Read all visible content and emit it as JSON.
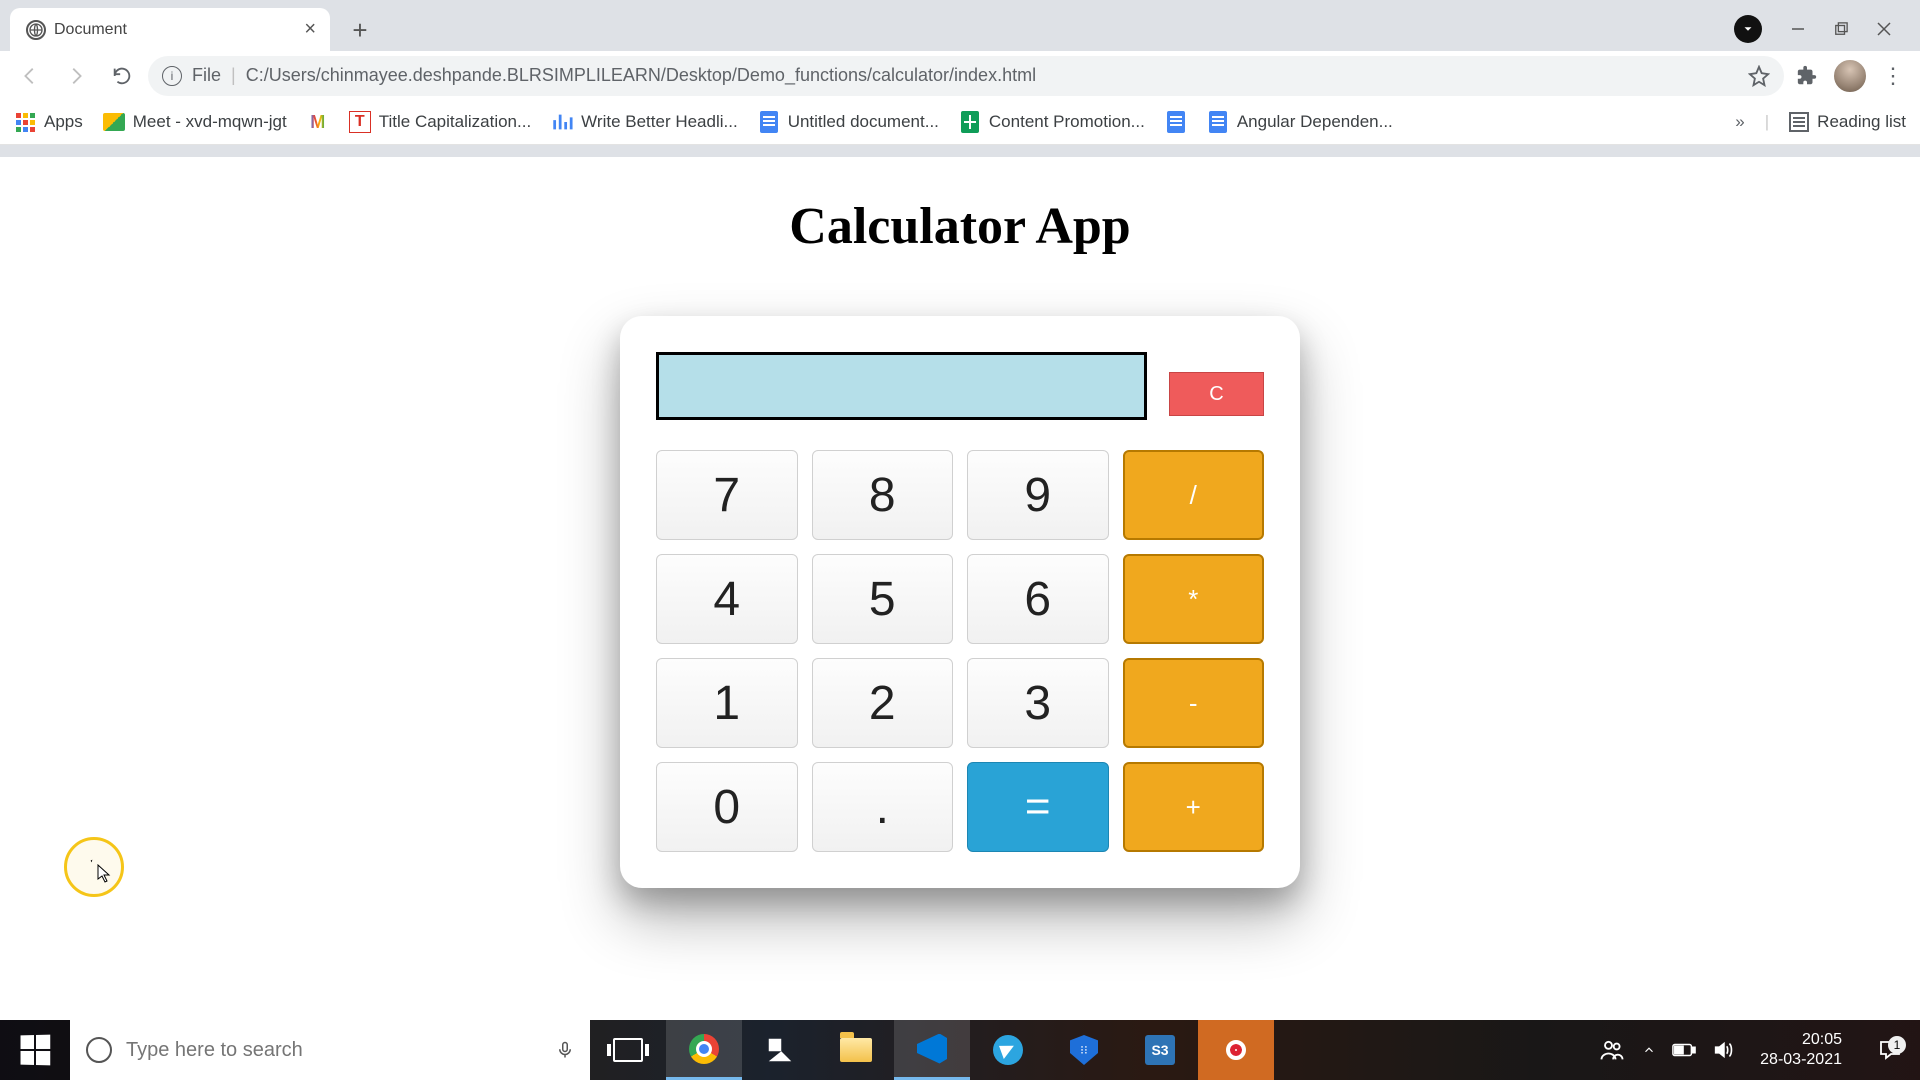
{
  "browser": {
    "tab_title": "Document",
    "file_label": "File",
    "url": "C:/Users/chinmayee.deshpande.BLRSIMPLILEARN/Desktop/Demo_functions/calculator/index.html"
  },
  "bookmarks": {
    "apps": "Apps",
    "meet": "Meet - xvd-mqwn-jgt",
    "title_cap": "Title Capitalization...",
    "write_better": "Write Better Headli...",
    "untitled_doc": "Untitled document...",
    "content_promo": "Content Promotion...",
    "angular_dep": "Angular Dependen...",
    "overflow": "»",
    "reading_list": "Reading list"
  },
  "page": {
    "heading": "Calculator App",
    "buttons": {
      "clear": "C",
      "k7": "7",
      "k8": "8",
      "k9": "9",
      "div": "/",
      "k4": "4",
      "k5": "5",
      "k6": "6",
      "mul": "*",
      "k1": "1",
      "k2": "2",
      "k3": "3",
      "sub": "-",
      "k0": "0",
      "dot": ".",
      "eq": "=",
      "add": "+"
    }
  },
  "taskbar": {
    "search_placeholder": "Type here to search",
    "s3_label": "S3",
    "time": "20:05",
    "date": "28-03-2021",
    "notif_count": "1"
  }
}
